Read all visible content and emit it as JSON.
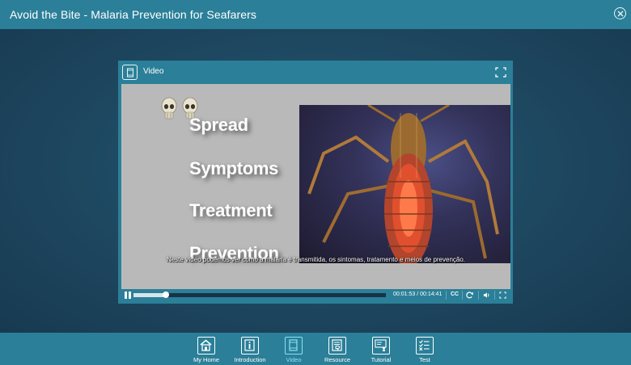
{
  "app": {
    "title": "Avoid the Bite - Malaria Prevention for Seafarers",
    "close_icon": "close-circle-icon"
  },
  "video_window": {
    "header_label": "Video",
    "header_icon": "film-icon",
    "fullscreen_icon": "fullscreen-icon"
  },
  "slide": {
    "words": [
      "Spread",
      "Symptoms",
      "Treatment",
      "Prevention"
    ],
    "subtitle": "Neste vídeo podemos ver como a malária é transmitida, os sintomas, tratamento e meios de prevenção.",
    "decor_icons": [
      "skull-icon",
      "skull-icon",
      "mosquito-image"
    ]
  },
  "player": {
    "state": "playing",
    "pause_icon": "pause-icon",
    "current_time": "00:01:53",
    "total_time": "00:14:41",
    "time_display": "00:01:53 / 00:14:41",
    "progress_fraction": 0.128,
    "cc_label": "CC",
    "replay_icon": "replay-icon",
    "volume_icon": "volume-icon",
    "fullscreen_icon": "fullscreen-icon"
  },
  "bottom_nav": {
    "items": [
      {
        "label": "My Home",
        "icon": "home-icon",
        "active": false
      },
      {
        "label": "Introduction",
        "icon": "info-icon",
        "active": false
      },
      {
        "label": "Video",
        "icon": "film-icon",
        "active": true
      },
      {
        "label": "Resource",
        "icon": "resource-icon",
        "active": false
      },
      {
        "label": "Tutorial",
        "icon": "tutorial-icon",
        "active": false
      },
      {
        "label": "Test",
        "icon": "test-checklist-icon",
        "active": false
      }
    ]
  },
  "colors": {
    "bar": "#2b7f98",
    "background": "#1d3d52",
    "active_nav": "#89e3f5",
    "video_bg": "#b9b9b9"
  }
}
